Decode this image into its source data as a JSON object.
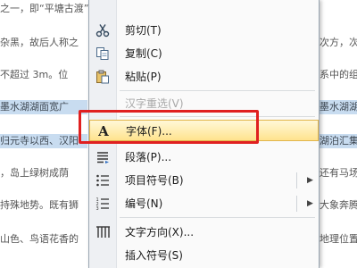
{
  "document": {
    "lines": [
      {
        "text": "之一，即“平塘古渡”。墨水湖湖面宽广，湖岸曲折，面积最大时曾达到",
        "sel": false
      },
      {
        "text": "杂黑，故后人称之",
        "sel": false,
        "right": "次方，次"
      },
      {
        "text": "不超过 3m。位",
        "sel": false,
        "right": "系中的组"
      },
      {
        "text": "墨水湖湖面宽广",
        "sel": true,
        "right": "墨水湖湖"
      },
      {
        "text": "归元寺以西、汉阳",
        "sel": true,
        "right": "湖泊汇集"
      },
      {
        "text": "，岛上绿树成荫",
        "sel": false,
        "right": "还有马场"
      },
      {
        "text": "持殊地势。既有狮",
        "sel": false,
        "right": "大象奔腾"
      },
      {
        "text": "山色、鸟语花香的",
        "sel": false,
        "right": "地理位置"
      }
    ]
  },
  "menu": {
    "items": [
      {
        "label": "剪切(T)",
        "icon": "scissors-icon",
        "glyph": "✂",
        "disabled": false,
        "submenu": false
      },
      {
        "label": "复制(C)",
        "icon": "copy-icon",
        "glyph": "❐",
        "disabled": false,
        "submenu": false
      },
      {
        "label": "粘贴(P)",
        "icon": "paste-icon",
        "glyph": "📋",
        "disabled": false,
        "submenu": false
      },
      {
        "label": "汉字重选(V)",
        "icon": "",
        "glyph": "",
        "disabled": true,
        "submenu": false
      },
      {
        "label": "字体(F)...",
        "icon": "font-icon",
        "glyph": "A",
        "disabled": false,
        "submenu": false,
        "highlight": true
      },
      {
        "label": "段落(P)...",
        "icon": "paragraph-icon",
        "glyph": "≡",
        "disabled": false,
        "submenu": false
      },
      {
        "label": "项目符号(B)",
        "icon": "bullets-icon",
        "glyph": "☰",
        "disabled": false,
        "submenu": true
      },
      {
        "label": "编号(N)",
        "icon": "numbering-icon",
        "glyph": "☰",
        "disabled": false,
        "submenu": true
      },
      {
        "label": "文字方向(X)...",
        "icon": "text-direction-icon",
        "glyph": "⫼",
        "disabled": false,
        "submenu": false
      },
      {
        "label": "插入符号(S)",
        "icon": "",
        "glyph": "",
        "disabled": false,
        "submenu": false
      }
    ]
  },
  "colors": {
    "highlight_border": "#e2b54a",
    "annotation_red": "#e02020",
    "selection_bg": "#c8dcf0"
  }
}
